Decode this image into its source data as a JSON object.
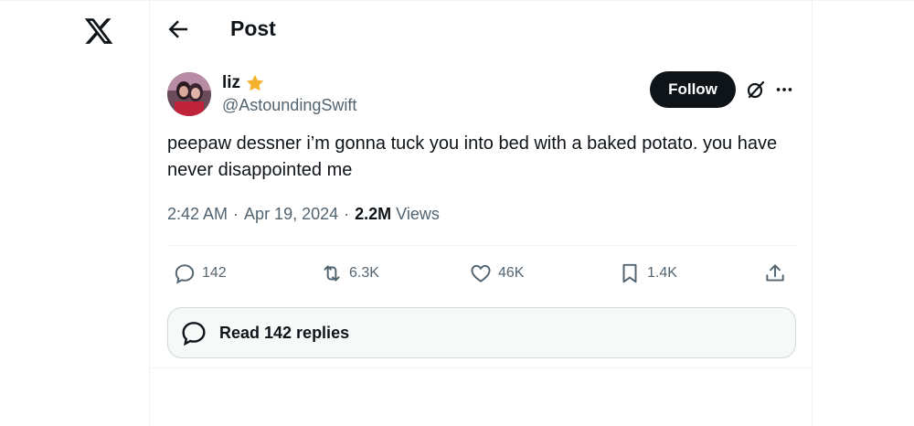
{
  "header": {
    "title": "Post"
  },
  "author": {
    "display_name": "liz",
    "handle": "@AstoundingSwift",
    "badge": "gold-star"
  },
  "follow_label": "Follow",
  "tweet": {
    "text": "peepaw dessner i’m gonna tuck you into bed with a baked potato. you have never disappointed me",
    "time": "2:42 AM",
    "sep1": "·",
    "date": "Apr 19, 2024",
    "sep2": "·",
    "views_count": "2.2M",
    "views_label": "Views"
  },
  "actions": {
    "replies": "142",
    "reposts": "6.3K",
    "likes": "46K",
    "bookmarks": "1.4K"
  },
  "read_replies_label": "Read 142 replies",
  "colors": {
    "text": "#0f1419",
    "secondary": "#536471",
    "star": "#f4b12c",
    "border": "#eff3f4"
  }
}
